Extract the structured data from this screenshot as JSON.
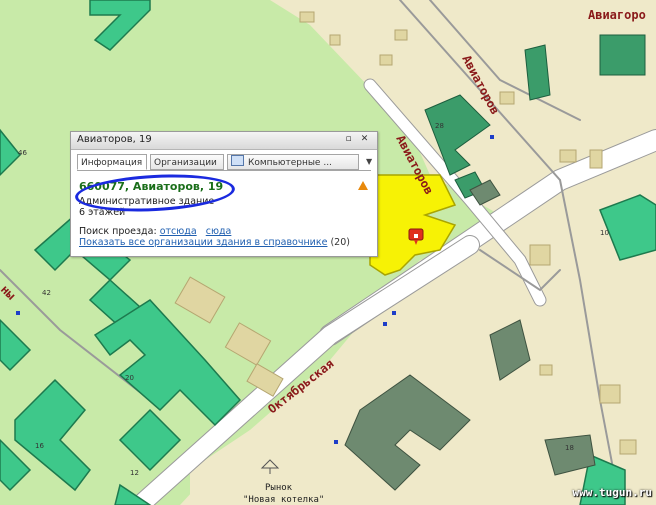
{
  "map": {
    "streets": {
      "aviatorov_diagonal": "Авиаторов",
      "aviatorov_top": "Авиагоро",
      "oktyabrskaya": "Октябрьская",
      "left_edge": "ны"
    },
    "market_name": "Рынок",
    "market_subtitle": "\"Новая котелка\"",
    "building_numbers": [
      "46",
      "42",
      "20",
      "16",
      "12",
      "28",
      "10",
      "18"
    ],
    "colors": {
      "land": "#efe9c9",
      "park": "#c8eaa8",
      "residential": "#3ec88a",
      "selected_building": "#f7f205",
      "industrial": "#6e8a70",
      "street_line": "#9a9a9a",
      "road": "#ffffff",
      "stop_marker": "#1e3ec8"
    },
    "marker_icon": "map-pin-icon"
  },
  "popup": {
    "title": "Авиаторов, 19",
    "tabs": [
      {
        "label": "Информация",
        "active": true
      },
      {
        "label": "Организации",
        "active": false
      },
      {
        "label": "Компьютерные ...",
        "active": false,
        "icon": "computer-icon"
      }
    ],
    "address": "660077, Авиаторов, 19",
    "building_type": "Административное здание",
    "floors": "6 этажей",
    "route_label": "Поиск проезда:",
    "route_from": "отсюда",
    "route_to": "сюда",
    "show_all_link": "Показать все организации здания в справочнике",
    "org_count": "(20)",
    "warning_icon": "warning-icon",
    "controls": [
      "minimize-icon",
      "close-icon"
    ]
  },
  "watermark": "www.tugun.ru"
}
